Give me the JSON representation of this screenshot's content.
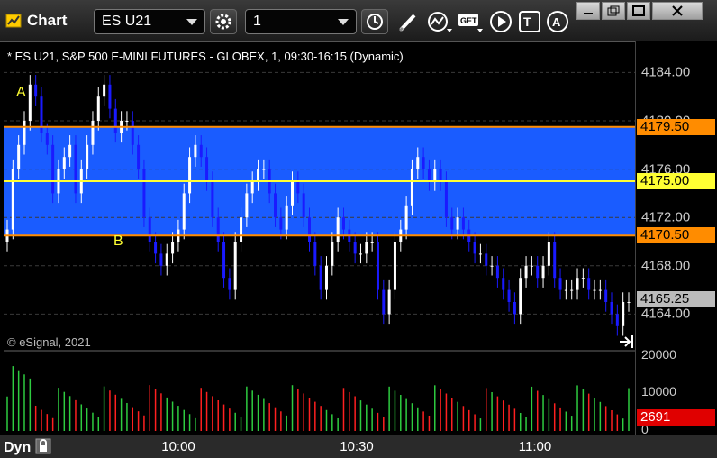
{
  "toolbar": {
    "title": "Chart",
    "symbol": "ES U21",
    "interval": "1",
    "icons": [
      "gear-icon",
      "clock-icon",
      "pencil-icon",
      "study-icon",
      "get-icon",
      "play-icon",
      "text-icon",
      "alert-icon"
    ]
  },
  "chart_header": "* ES U21, S&P 500 E-MINI FUTURES - GLOBEX, 1, 09:30-16:15 (Dynamic)",
  "copyright": "© eSignal, 2021",
  "footer": {
    "mode": "Dyn",
    "time_labels": [
      "10:00",
      "10:30",
      "11:00"
    ]
  },
  "colors": {
    "band": "#1a5cff",
    "band_edge": "#ff8c00",
    "midline": "#ffff33",
    "up": "#ffffff",
    "down": "#1a1aff",
    "vol_up": "#2ecc40",
    "vol_down": "#ff2020",
    "last_price_bg": "#bbbbbb",
    "last_vol_bg": "#e00000"
  },
  "chart_data": [
    {
      "type": "candlestick",
      "title": "",
      "ylim": [
        4162,
        4186
      ],
      "y_ticks": [
        "4164.00",
        "4168.00",
        "4172.00",
        "4176.00",
        "4180.00",
        "4184.00"
      ],
      "levels": [
        {
          "label": "4179.50",
          "value": 4179.5,
          "color": "#ff8c00"
        },
        {
          "label": "4175.00",
          "value": 4175.0,
          "color": "#ffff33"
        },
        {
          "label": "4170.50",
          "value": 4170.5,
          "color": "#ff8c00"
        }
      ],
      "last_price": "4165.25",
      "annotations": [
        {
          "text": "A",
          "near_price": 4183.0
        },
        {
          "text": "B",
          "near_price": 4170.0
        }
      ],
      "closes": [
        4171,
        4176,
        4178,
        4180,
        4183,
        4182,
        4179,
        4178,
        4174,
        4176,
        4177,
        4178,
        4174,
        4176,
        4178,
        4180,
        4182,
        4183,
        4181,
        4179,
        4180,
        4180,
        4178,
        4176,
        4172,
        4170,
        4169,
        4168,
        4169,
        4170,
        4171,
        4174,
        4177,
        4178,
        4177,
        4175,
        4172,
        4170,
        4167,
        4166,
        4170,
        4172,
        4174,
        4175,
        4176,
        4176,
        4174,
        4172,
        4171,
        4173,
        4175,
        4174,
        4172,
        4170,
        4168,
        4166,
        4168,
        4170,
        4172,
        4171,
        4170,
        4169,
        4169,
        4170,
        4170,
        4166,
        4164,
        4166,
        4170,
        4171,
        4173,
        4176,
        4177,
        4176,
        4175,
        4176,
        4175,
        4172,
        4171,
        4172,
        4171,
        4170,
        4169,
        4169,
        4168,
        4168,
        4167,
        4166,
        4165,
        4164,
        4167,
        4168,
        4168,
        4167,
        4168,
        4170,
        4167,
        4166,
        4166,
        4166,
        4167,
        4167,
        4166,
        4166,
        4166,
        4165,
        4164,
        4163,
        4165,
        4165
      ],
      "volume_labels": [
        "20000",
        "10000",
        "0"
      ],
      "volume_ylim": [
        0,
        20000
      ],
      "last_volume": "2691",
      "x_labels": [
        "10:00",
        "10:30",
        "11:00"
      ]
    }
  ]
}
